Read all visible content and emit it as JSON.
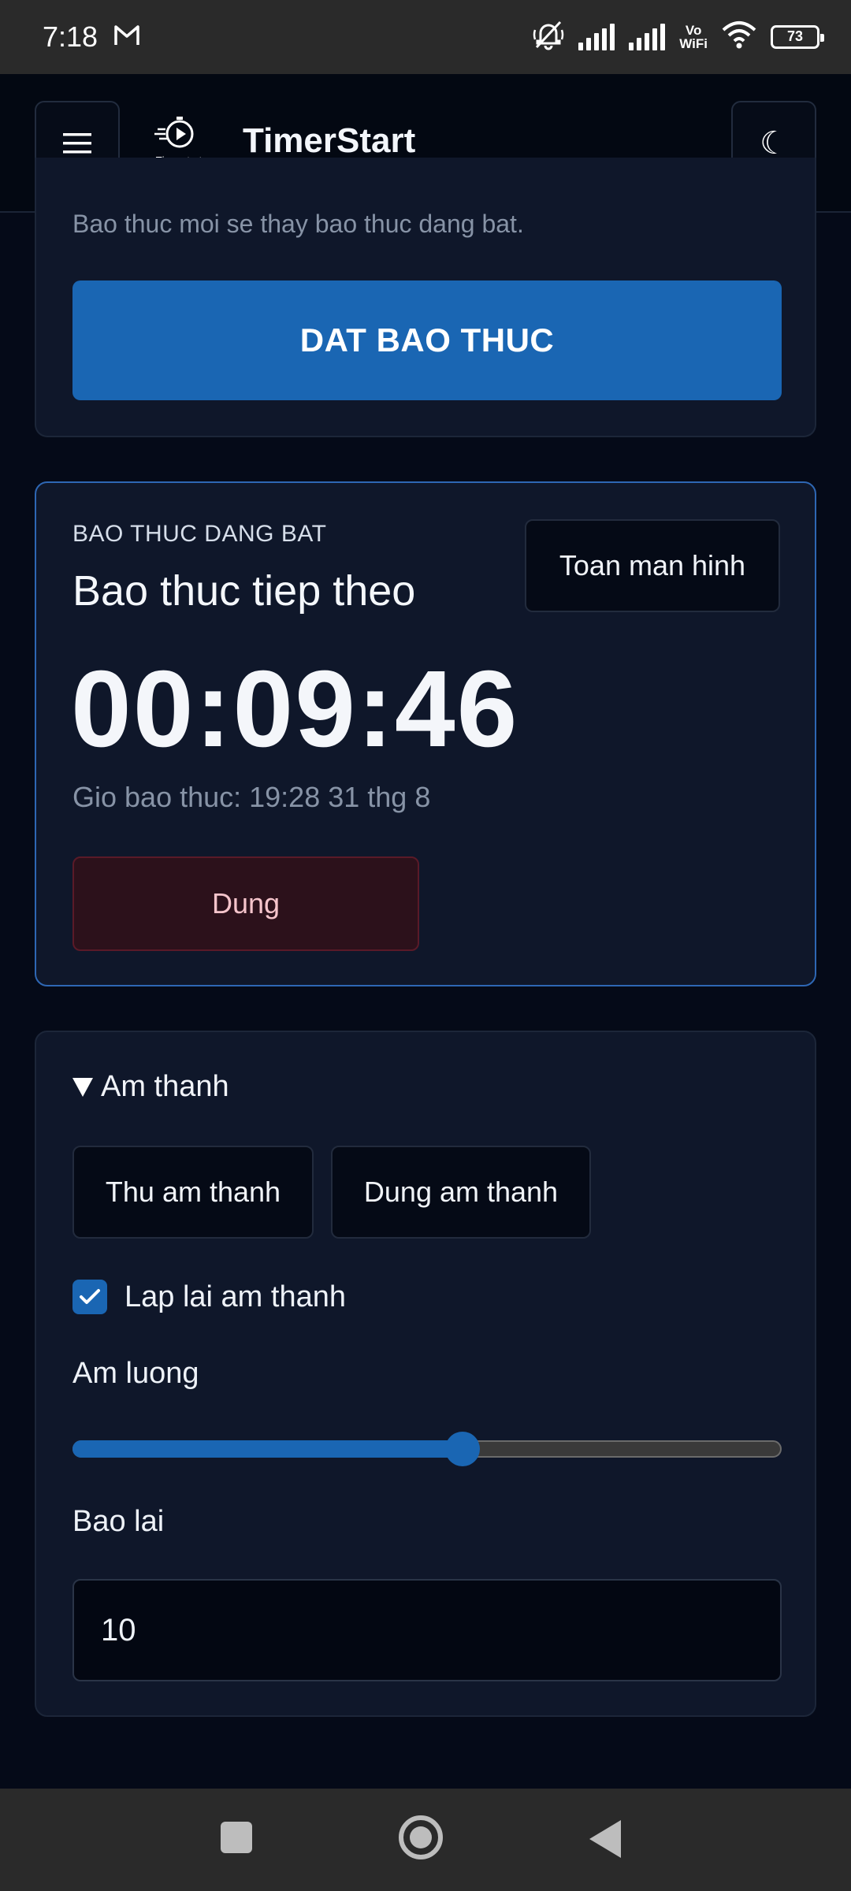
{
  "status_bar": {
    "time": "7:18",
    "vo_wifi_top": "Vo",
    "vo_wifi_bottom": "WiFi",
    "battery": "73"
  },
  "header": {
    "app_title": "TimerStart",
    "logo_text": "Timerstart",
    "menu_icon": "hamburger-icon",
    "theme_icon": "moon-icon",
    "theme_glyph": "☾"
  },
  "set_alarm": {
    "hint": "Bao thuc moi se thay bao thuc dang bat.",
    "button_label": "DAT BAO THUC"
  },
  "active_alarm": {
    "eyebrow": "BAO THUC DANG BAT",
    "title": "Bao thuc tiep theo",
    "fullscreen_label": "Toan man hinh",
    "countdown": "00:09:46",
    "alarm_time": "Gio bao thuc: 19:28 31 thg 8",
    "stop_label": "Dung"
  },
  "sound": {
    "section_label": "Am thanh",
    "test_label": "Thu am thanh",
    "stop_sound_label": "Dung am thanh",
    "repeat_label": "Lap lai am thanh",
    "repeat_checked": true,
    "volume_label": "Am luong",
    "volume_fraction": 0.55,
    "snooze_label": "Bao lai",
    "snooze_value": "10"
  },
  "colors": {
    "accent": "#1a66b3",
    "background": "#050a18",
    "card": "#0f172a",
    "danger_bg": "#2c111b"
  }
}
